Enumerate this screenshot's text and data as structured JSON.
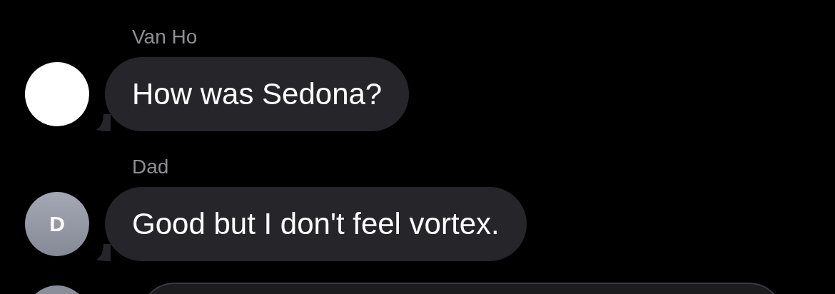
{
  "messages": [
    {
      "sender": "Van Ho",
      "text": "How was Sedona?"
    },
    {
      "sender": "Dad",
      "text": "Good but I don't feel vortex.",
      "avatar": {
        "kind": "initial",
        "initial": "D"
      }
    }
  ],
  "next_message": {
    "kind": "partial"
  }
}
